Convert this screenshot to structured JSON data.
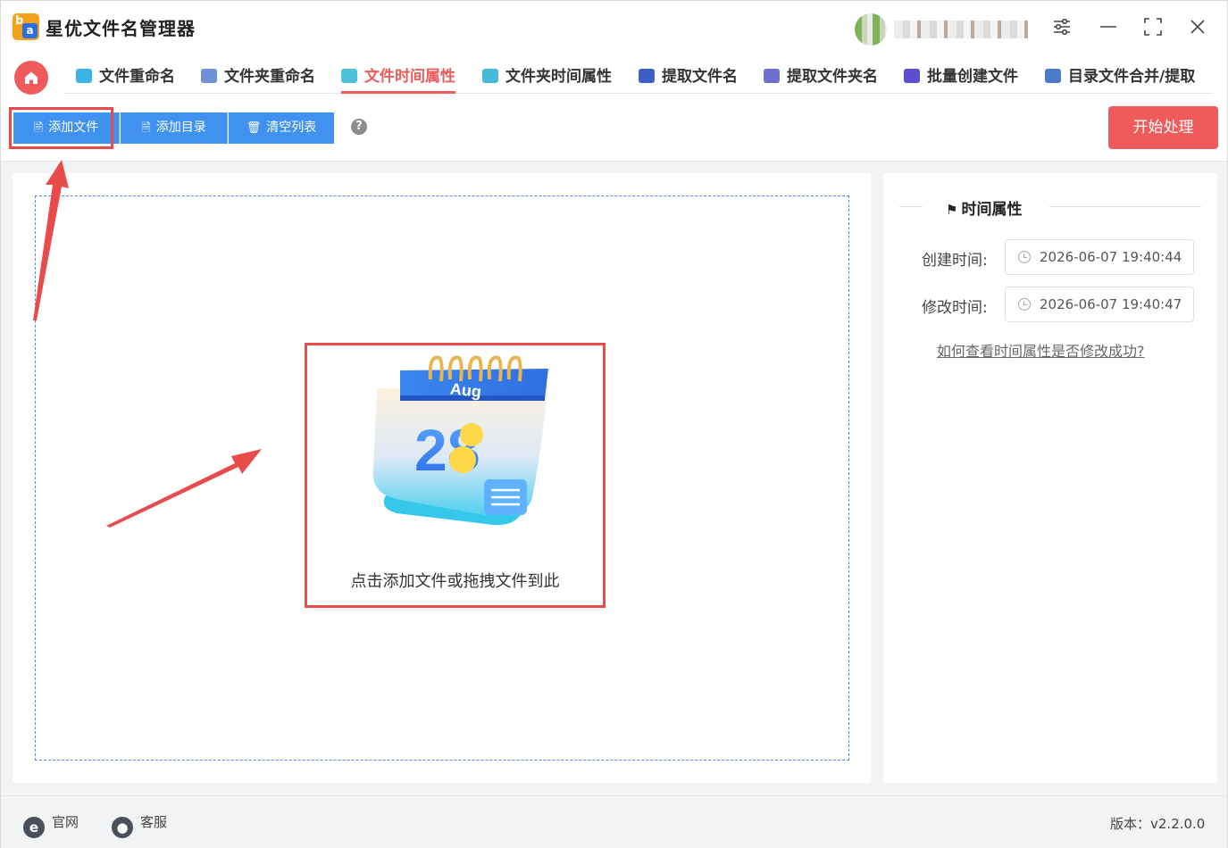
{
  "app": {
    "title": "星优文件名管理器",
    "logo_letters": "a"
  },
  "window_controls": {
    "settings_icon": "sliders-icon",
    "minimize": "—",
    "maximize": "⛶",
    "close": "✕"
  },
  "nav": {
    "tabs": [
      {
        "label": "文件重命名",
        "icon": "rename-icon",
        "color": "#3bb3e6"
      },
      {
        "label": "文件夹重命名",
        "icon": "folder-rename-icon",
        "color": "#6f8fd6"
      },
      {
        "label": "文件时间属性",
        "icon": "file-time-icon",
        "color": "#4cc3d9",
        "active": true
      },
      {
        "label": "文件夹时间属性",
        "icon": "folder-time-icon",
        "color": "#49b9d8"
      },
      {
        "label": "提取文件名",
        "icon": "extract-name-icon",
        "color": "#3c5ec9"
      },
      {
        "label": "提取文件夹名",
        "icon": "extract-folder-icon",
        "color": "#6f6fd0"
      },
      {
        "label": "批量创建文件",
        "icon": "batch-create-icon",
        "color": "#5b4fcf"
      },
      {
        "label": "目录文件合并/提取",
        "icon": "merge-icon",
        "color": "#4d7ac9"
      }
    ]
  },
  "toolbar": {
    "add_file": "添加文件",
    "add_dir": "添加目录",
    "clear_list": "清空列表",
    "help": "?",
    "start": "开始处理"
  },
  "dropzone": {
    "hint": "点击添加文件或拖拽文件到此",
    "calendar_month": "Aug",
    "calendar_day": "28"
  },
  "time_panel": {
    "title": "时间属性",
    "created_label": "创建时间:",
    "created_value": "2026-06-07 19:40:44",
    "modified_label": "修改时间:",
    "modified_value": "2026-06-07 19:40:47",
    "help_link": "如何查看时间属性是否修改成功?"
  },
  "statusbar": {
    "website": "官网",
    "support": "客服",
    "version": "版本：v2.2.0.0"
  }
}
